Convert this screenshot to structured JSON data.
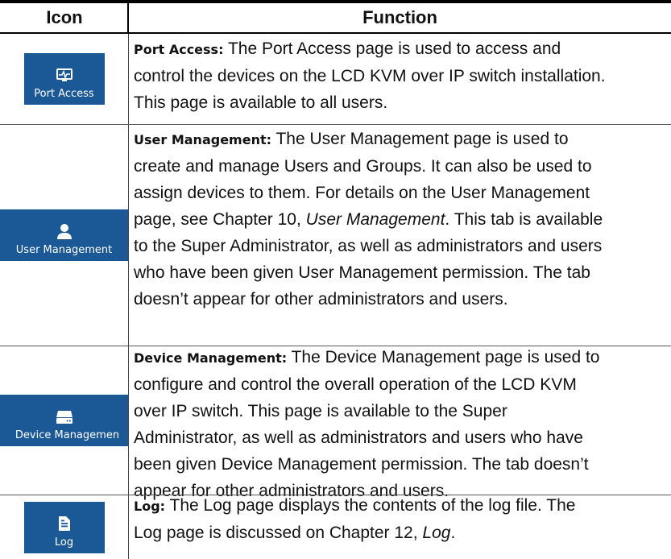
{
  "header": {
    "icon_col": "Icon",
    "function_col": "Function"
  },
  "rows": [
    {
      "tile_label": "Port Access",
      "icon": "monitor-pulse-icon",
      "title": "Port Access:",
      "lines": [
        " The Port Access page is used to access and",
        "control the devices on the LCD KVM over IP switch installation.",
        "This page is available to all users."
      ]
    },
    {
      "tile_label": "User Management",
      "icon": "user-icon",
      "title": "User Management:",
      "lines": [
        " The User Management page is used to",
        "create and manage Users and Groups. It can also be used to",
        "assign devices to them. For details on the User Management",
        "page, see Chapter 10, ",
        "User Management",
        ". This tab is available",
        "to the Super Administrator, as well as administrators and users",
        "who have been given User Management permission. The tab",
        "doesn’t appear for other administrators and users."
      ]
    },
    {
      "tile_label": "Device Managemen",
      "icon": "server-drive-icon",
      "title": "Device Management:",
      "lines": [
        " The Device Management page is used to",
        "configure and control the overall operation of the LCD KVM",
        "over IP switch. This page is available to the Super",
        "Administrator, as well as administrators and users who have",
        "been given Device Management permission. The tab doesn’t",
        "appear for other administrators and users."
      ]
    },
    {
      "tile_label": "Log",
      "icon": "document-icon",
      "title": "Log:",
      "lines": [
        " The Log page displays the contents of the log file. The",
        "Log page is discussed on Chapter 12, ",
        "Log",
        "."
      ]
    }
  ],
  "colors": {
    "tile_bg": "#1b5896",
    "tile_fg": "#ffffff",
    "rule": "#000000"
  }
}
